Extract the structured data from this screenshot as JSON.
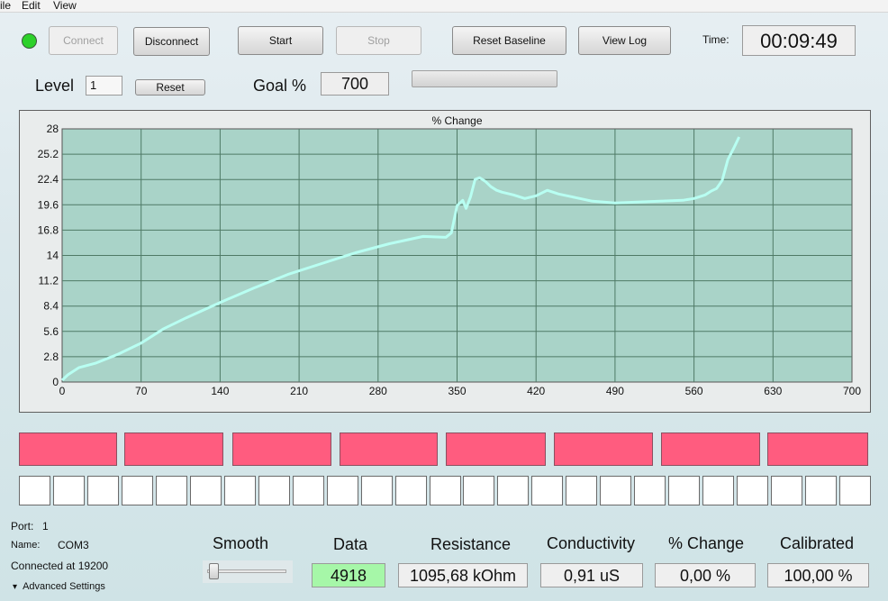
{
  "menu": {
    "file": "ile",
    "edit": "Edit",
    "view": "View"
  },
  "toolbar": {
    "connect": "Connect",
    "disconnect": "Disconnect",
    "start": "Start",
    "stop": "Stop",
    "reset_baseline": "Reset Baseline",
    "view_log": "View Log",
    "time_label": "Time:",
    "time_value": "00:09:49",
    "status_color": "#2cd12a"
  },
  "level": {
    "label": "Level",
    "value": "1",
    "reset": "Reset"
  },
  "goal": {
    "label": "Goal %",
    "value": "700",
    "progress": 0
  },
  "chart_data": {
    "type": "line",
    "title": "% Change",
    "xlabel": "",
    "ylabel": "",
    "xlim": [
      0,
      700
    ],
    "ylim": [
      0,
      28
    ],
    "x_ticks": [
      0,
      70,
      140,
      210,
      280,
      350,
      420,
      490,
      560,
      630,
      700
    ],
    "y_ticks": [
      0,
      2.8,
      5.6,
      8.4,
      11.2,
      14,
      16.8,
      19.6,
      22.4,
      25.2,
      28
    ],
    "y_tick_labels": [
      "0",
      "2.8",
      "5.6",
      "8.4",
      "11.2",
      "14",
      "16.8",
      "19.6",
      "22.4",
      "25.2",
      "28"
    ],
    "grid": true,
    "line_color": "#b8fff2",
    "plot_bg": "#a9d3c8",
    "series": [
      {
        "x": [
          0,
          5,
          15,
          30,
          50,
          70,
          90,
          110,
          140,
          170,
          200,
          230,
          260,
          290,
          320,
          340,
          345,
          350,
          355,
          358,
          362,
          366,
          370,
          375,
          380,
          385,
          390,
          400,
          410,
          420,
          430,
          440,
          455,
          470,
          490,
          510,
          530,
          550,
          560,
          570,
          575,
          580,
          585,
          590,
          595,
          600
        ],
        "y": [
          0.2,
          0.8,
          1.6,
          2.1,
          3.1,
          4.3,
          5.9,
          7.1,
          8.8,
          10.4,
          11.9,
          13.1,
          14.3,
          15.3,
          16.1,
          16.0,
          16.5,
          19.5,
          20.1,
          19.2,
          20.5,
          22.4,
          22.6,
          22.2,
          21.6,
          21.2,
          21.0,
          20.7,
          20.3,
          20.6,
          21.2,
          20.8,
          20.4,
          20.0,
          19.8,
          19.9,
          20.0,
          20.1,
          20.3,
          20.7,
          21.1,
          21.4,
          22.3,
          24.6,
          25.8,
          27.1
        ]
      }
    ]
  },
  "meters": {
    "count": 8,
    "color": "#ff5c7f"
  },
  "cells": {
    "count": 25
  },
  "port": {
    "port_label": "Port:",
    "port_value": "1",
    "name_label": "Name:",
    "name_value": "COM3",
    "connected": "Connected at 19200",
    "advanced": "Advanced Settings"
  },
  "smooth": {
    "label": "Smooth",
    "level": 0
  },
  "readouts": {
    "data_label": "Data",
    "data_value": "4918",
    "resistance_label": "Resistance",
    "resistance_value": "1095,68 kOhm",
    "conductivity_label": "Conductivity",
    "conductivity_value": "0,91 uS",
    "change_label": "% Change",
    "change_value": "0,00 %",
    "calibrated_label": "Calibrated",
    "calibrated_value": "100,00 %"
  }
}
